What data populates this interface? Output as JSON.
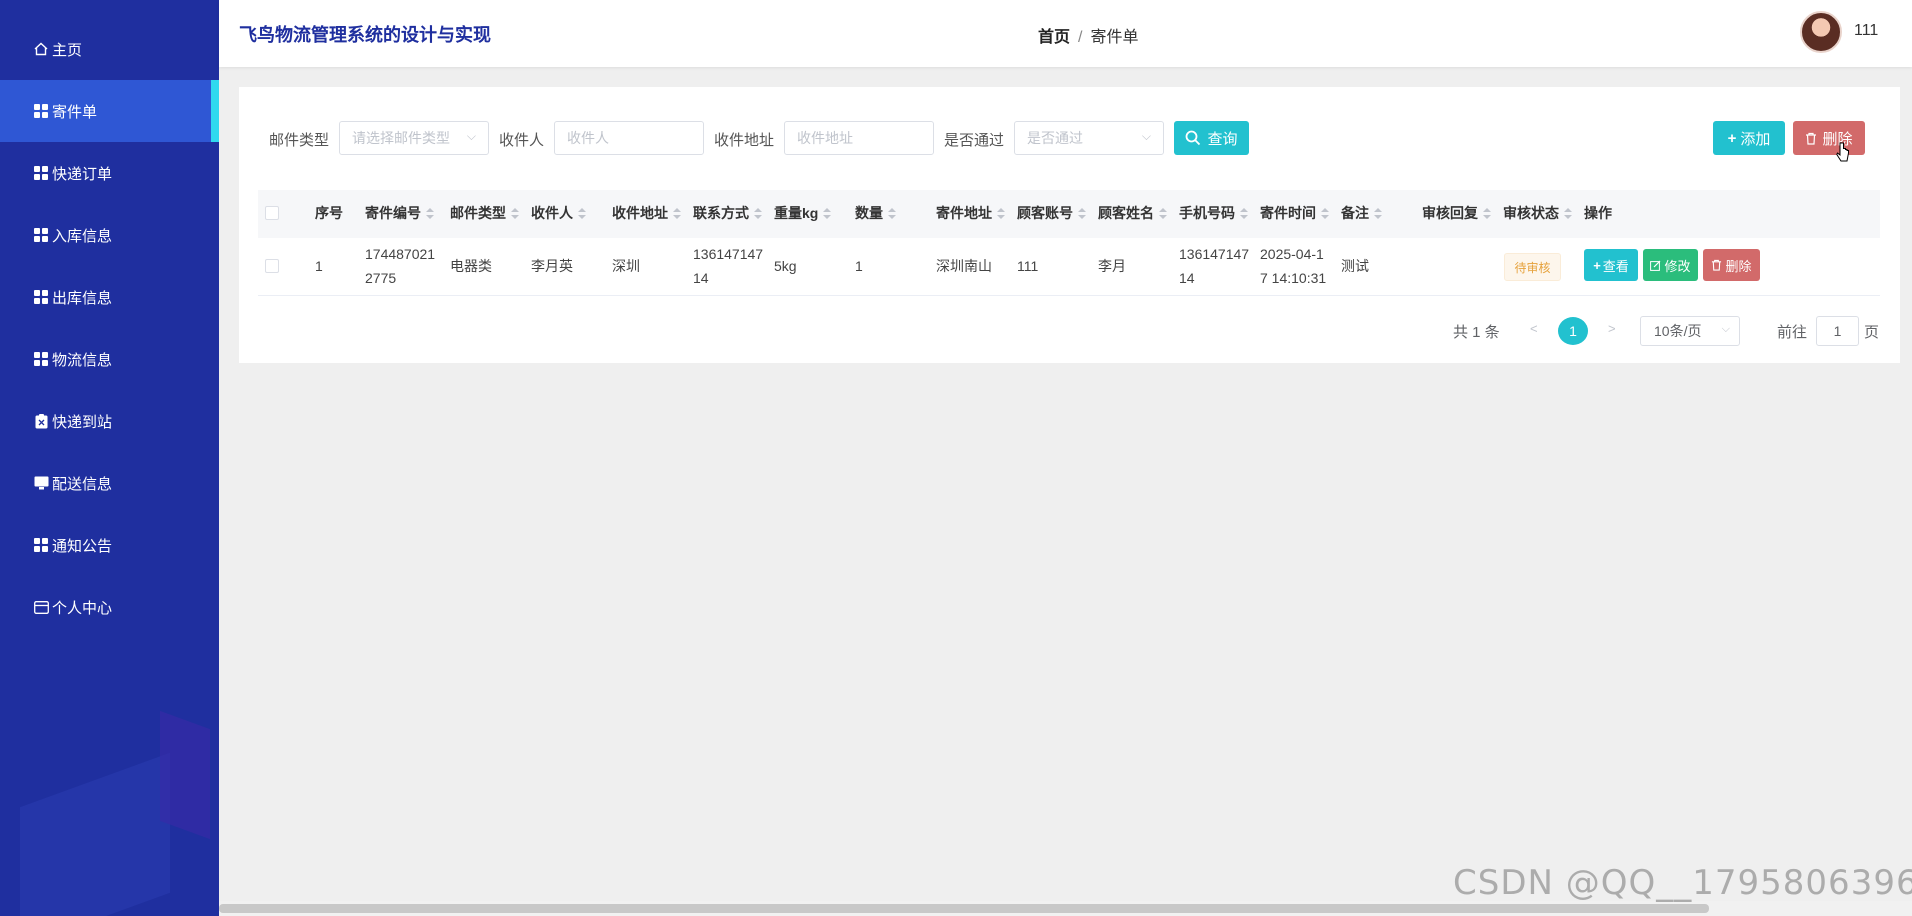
{
  "app": {
    "title": "飞鸟物流管理系统的设计与实现"
  },
  "breadcrumb": {
    "home": "首页",
    "separator": "/",
    "current": "寄件单"
  },
  "user": {
    "name": "111"
  },
  "sidebar": {
    "items": [
      {
        "label": "主页",
        "icon": "home-icon"
      },
      {
        "label": "寄件单",
        "icon": "grid-icon",
        "active": true
      },
      {
        "label": "快递订单",
        "icon": "grid-icon"
      },
      {
        "label": "入库信息",
        "icon": "grid-icon"
      },
      {
        "label": "出库信息",
        "icon": "grid-icon"
      },
      {
        "label": "物流信息",
        "icon": "grid-icon"
      },
      {
        "label": "快递到站",
        "icon": "clipboard-icon"
      },
      {
        "label": "配送信息",
        "icon": "monitor-icon"
      },
      {
        "label": "通知公告",
        "icon": "grid-icon"
      },
      {
        "label": "个人中心",
        "icon": "card-icon"
      }
    ]
  },
  "filters": {
    "mail_type": {
      "label": "邮件类型",
      "placeholder": "请选择邮件类型"
    },
    "recipient": {
      "label": "收件人",
      "placeholder": "收件人"
    },
    "address": {
      "label": "收件地址",
      "placeholder": "收件地址"
    },
    "approved": {
      "label": "是否通过",
      "placeholder": "是否通过"
    },
    "search_button": "查询"
  },
  "toolbar": {
    "add_label": "添加",
    "delete_label": "删除"
  },
  "table": {
    "headers": [
      "序号",
      "寄件编号",
      "邮件类型",
      "收件人",
      "收件地址",
      "联系方式",
      "重量kg",
      "数量",
      "寄件地址",
      "顾客账号",
      "顾客姓名",
      "手机号码",
      "寄件时间",
      "备注",
      "审核回复",
      "审核状态",
      "操作"
    ],
    "rows": [
      {
        "index": "1",
        "number_l1": "174487021",
        "number_l2": "2775",
        "mail_type": "电器类",
        "recipient": "李月英",
        "address": "深圳",
        "contact_l1": "136147147",
        "contact_l2": "14",
        "weight": "5kg",
        "quantity": "1",
        "from_address": "深圳南山",
        "account": "111",
        "customer_name": "李月",
        "phone_l1": "136147147",
        "phone_l2": "14",
        "time_l1": "2025-04-1",
        "time_l2": "7 14:10:31",
        "remark": "测试",
        "reply": "",
        "status": "待审核",
        "actions": {
          "view": "查看",
          "edit": "修改",
          "delete": "删除"
        }
      }
    ]
  },
  "pagination": {
    "total": "共 1 条",
    "prev": "<",
    "current": "1",
    "next": ">",
    "page_size": "10条/页",
    "goto_label": "前往",
    "goto_value": "1",
    "page_unit": "页"
  },
  "watermark": "CSDN @QQ__1795806396",
  "colors": {
    "sidebar": "#1f2f9f",
    "active": "#2f57d4",
    "accent": "#22c1cf",
    "danger": "#d26a6a",
    "success": "#2bbd7c"
  }
}
